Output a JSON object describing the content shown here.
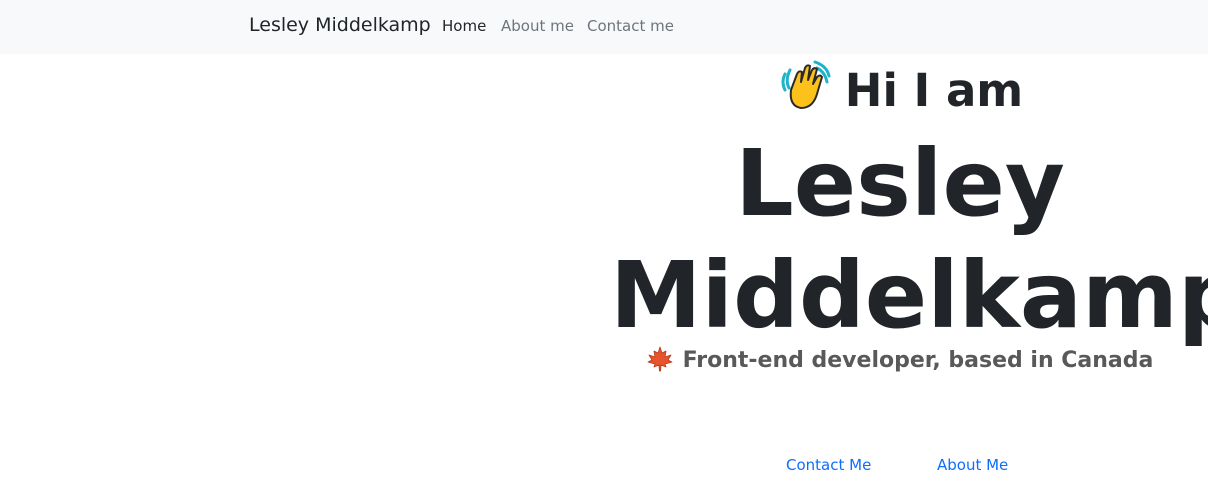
{
  "navbar": {
    "brand": "Lesley Middelkamp",
    "links": [
      {
        "label": "Home",
        "active": true
      },
      {
        "label": "About me",
        "active": false
      },
      {
        "label": "Contact me",
        "active": false
      }
    ]
  },
  "hero": {
    "greeting": "Hi I am",
    "greeting_icon": "waving-hand-icon",
    "name_line1": "Lesley",
    "name_line2": "Middelkamp",
    "tagline": "Front-end developer, based in Canada",
    "tagline_icon": "maple-leaf-icon"
  },
  "actions": {
    "contact_label": "Contact Me",
    "about_label": "About Me"
  },
  "colors": {
    "navbar_bg": "#f8f9fa",
    "text": "#212529",
    "muted": "#6c757d",
    "link": "#0d6efd",
    "tagline": "#595959"
  }
}
